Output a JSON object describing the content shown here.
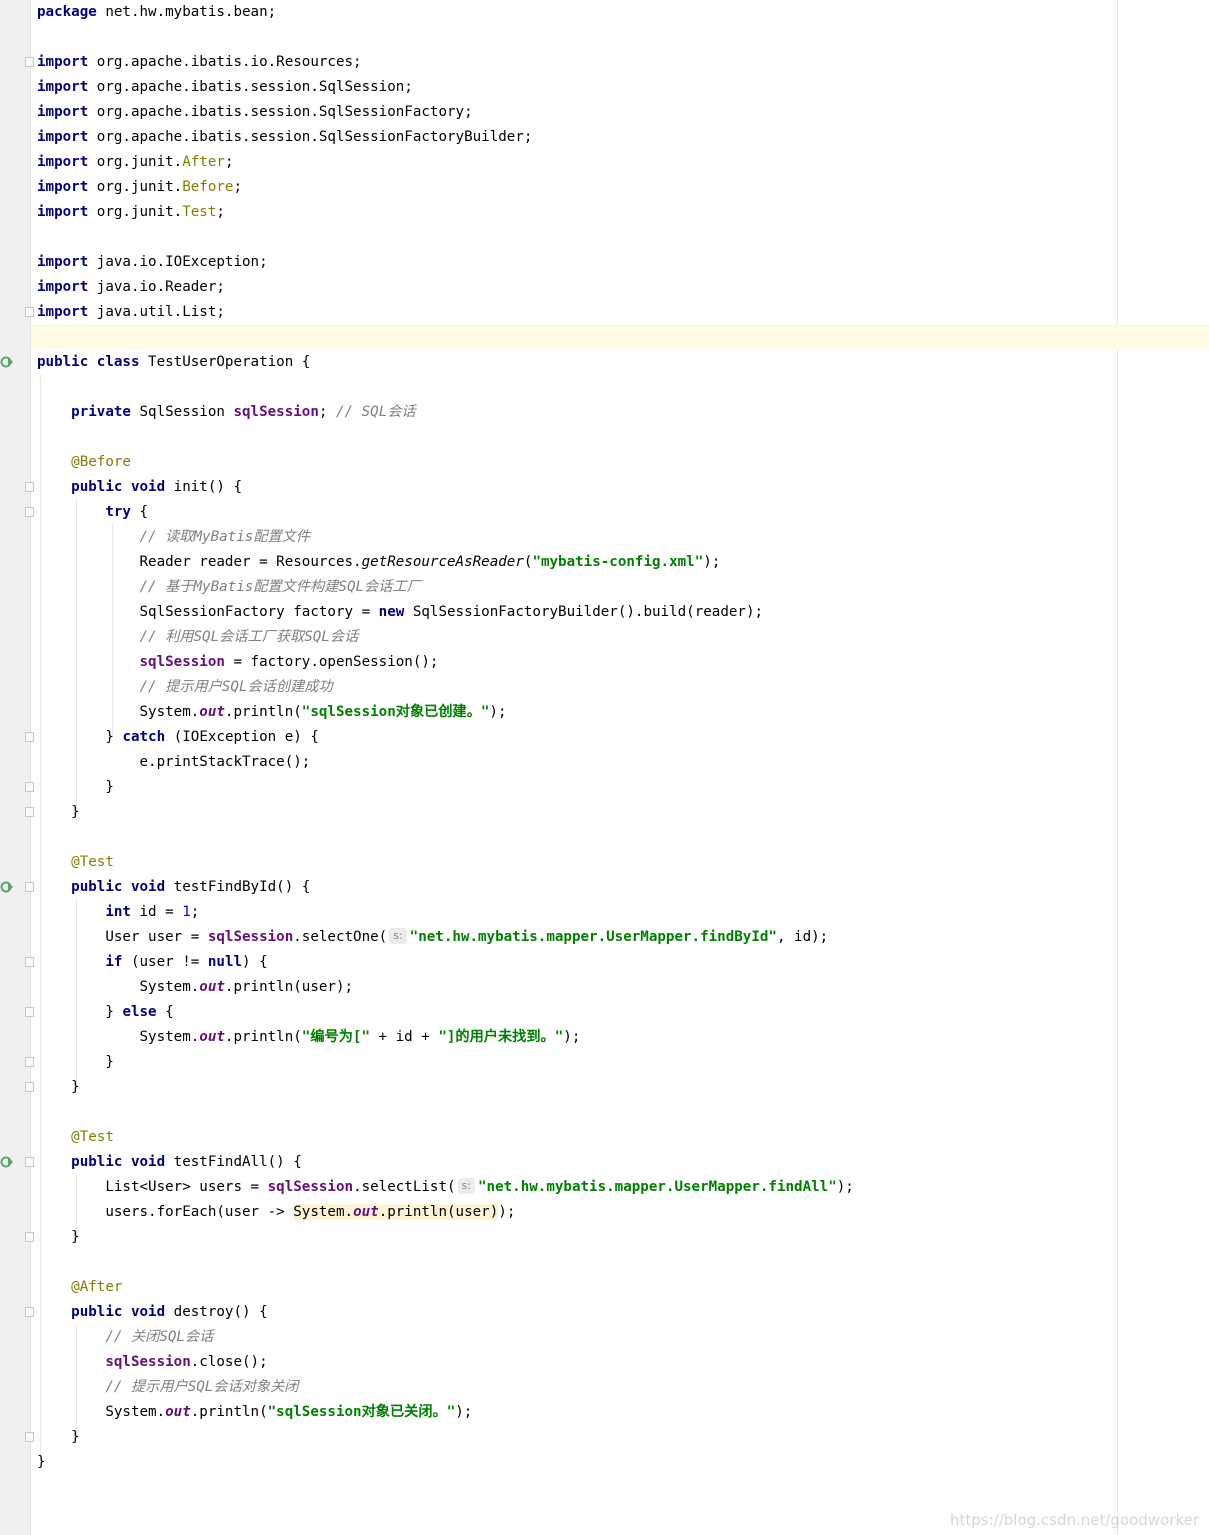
{
  "file": {
    "package_kw": "package",
    "package_name": " net.hw.mybatis.bean;",
    "imports": [
      {
        "kw": "import",
        "pre": " org.apache.ibatis.io.Resources;",
        "ann": "",
        "post": ""
      },
      {
        "kw": "import",
        "pre": " org.apache.ibatis.session.SqlSession;",
        "ann": "",
        "post": ""
      },
      {
        "kw": "import",
        "pre": " org.apache.ibatis.session.SqlSessionFactory;",
        "ann": "",
        "post": ""
      },
      {
        "kw": "import",
        "pre": " org.apache.ibatis.session.SqlSessionFactoryBuilder;",
        "ann": "",
        "post": ""
      },
      {
        "kw": "import",
        "pre": " org.junit.",
        "ann": "After",
        "post": ";"
      },
      {
        "kw": "import",
        "pre": " org.junit.",
        "ann": "Before",
        "post": ";"
      },
      {
        "kw": "import",
        "pre": " org.junit.",
        "ann": "Test",
        "post": ";"
      },
      {
        "kw": "import",
        "pre": " java.io.IOException;",
        "ann": "",
        "post": ""
      },
      {
        "kw": "import",
        "pre": " java.io.Reader;",
        "ann": "",
        "post": ""
      },
      {
        "kw": "import",
        "pre": " java.util.List;",
        "ann": "",
        "post": ""
      }
    ],
    "class_decl": {
      "kw1": "public",
      "kw2": "class",
      "name": " TestUserOperation {"
    },
    "field": {
      "kw": "private",
      "type": " SqlSession ",
      "name": "sqlSession",
      "semi": "; ",
      "comment": "// SQL会话"
    },
    "init": {
      "annotation": "@Before",
      "sig_kw1": "public",
      "sig_kw2": "void",
      "sig_rest": " init() {",
      "try_kw": "try",
      "try_rest": " {",
      "c1": "// 读取MyBatis配置文件",
      "l1_a": "Reader reader = Resources.",
      "l1_m": "getResourceAsReader",
      "l1_b": "(",
      "l1_s": "\"mybatis-config.xml\"",
      "l1_c": ");",
      "c2": "// 基于MyBatis配置文件构建SQL会话工厂",
      "l2_a": "SqlSessionFactory factory = ",
      "l2_kw": "new",
      "l2_b": " SqlSessionFactoryBuilder().build(reader);",
      "c3": "// 利用SQL会话工厂获取SQL会话",
      "l3_f": "sqlSession",
      "l3_b": " = factory.openSession();",
      "c4": "// 提示用户SQL会话创建成功",
      "l4_a": "System.",
      "l4_out": "out",
      "l4_b": ".println(",
      "l4_s": "\"sqlSession对象已创建。\"",
      "l4_c": ");",
      "catch_a": "} ",
      "catch_kw": "catch",
      "catch_b": " (IOException e) {",
      "catch_body": "e.printStackTrace();",
      "close1": "}",
      "close2": "}"
    },
    "find_by_id": {
      "annotation": "@Test",
      "sig_kw1": "public",
      "sig_kw2": "void",
      "sig_rest": " testFindById() {",
      "l1_kw": "int",
      "l1_a": " id = ",
      "l1_num": "1",
      "l1_b": ";",
      "l2_a": "User user = ",
      "l2_f": "sqlSession",
      "l2_b": ".selectOne(",
      "l2_hint": "s:",
      "l2_s": "\"net.hw.mybatis.mapper.UserMapper.findById\"",
      "l2_c": ", id);",
      "if_kw": "if",
      "if_a": " (user != ",
      "if_null": "null",
      "if_b": ") {",
      "l3_a": "System.",
      "l3_out": "out",
      "l3_b": ".println(user);",
      "else_a": "} ",
      "else_kw": "else",
      "else_b": " {",
      "l4_a": "System.",
      "l4_out": "out",
      "l4_b": ".println(",
      "l4_s1": "\"编号为[\"",
      "l4_mid": " + id + ",
      "l4_s2": "\"]的用户未找到。\"",
      "l4_c": ");",
      "close1": "}",
      "close2": "}"
    },
    "find_all": {
      "annotation": "@Test",
      "sig_kw1": "public",
      "sig_kw2": "void",
      "sig_rest": " testFindAll() {",
      "l1_a": "List<User> users = ",
      "l1_f": "sqlSession",
      "l1_b": ".selectList(",
      "l1_hint": "s:",
      "l1_s": "\"net.hw.mybatis.mapper.UserMapper.findAll\"",
      "l1_c": ");",
      "l2_a": "users.forEach(user -> ",
      "l2_h1": "System.",
      "l2_out": "out",
      "l2_h2": ".println(user)",
      "l2_c": ");",
      "close": "}"
    },
    "destroy": {
      "annotation": "@After",
      "sig_kw1": "public",
      "sig_kw2": "void",
      "sig_rest": " destroy() {",
      "c1": "// 关闭SQL会话",
      "l1_f": "sqlSession",
      "l1_b": ".close();",
      "c2": "// 提示用户SQL会话对象关闭",
      "l2_a": "System.",
      "l2_out": "out",
      "l2_b": ".println(",
      "l2_s": "\"sqlSession对象已关闭。\"",
      "l2_c": ");",
      "close": "}"
    },
    "class_close": "}"
  },
  "watermark": "https://blog.csdn.net/goodworker",
  "colors": {
    "keyword": "#000080",
    "annotation": "#808000",
    "string": "#008000",
    "comment": "#808080",
    "field": "#660e7a",
    "number": "#0000ff"
  },
  "icons": {
    "run": "run-test-icon",
    "fold": "fold-marker-icon"
  }
}
